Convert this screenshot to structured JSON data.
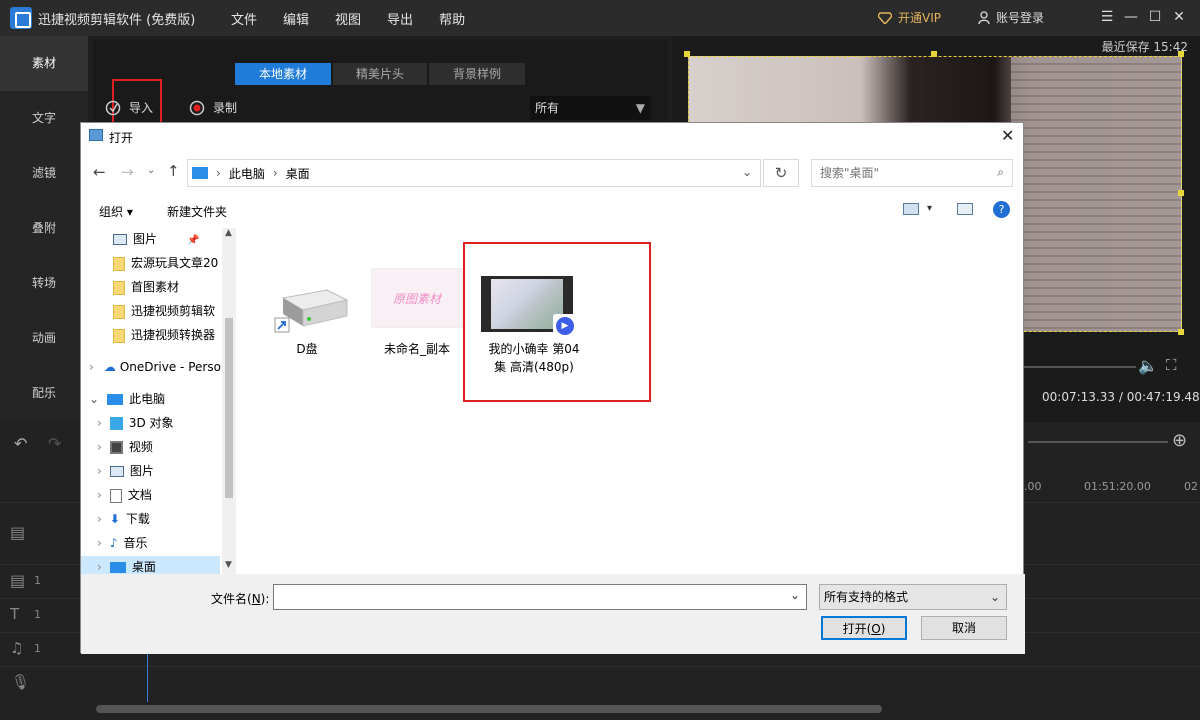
{
  "app": {
    "title": "迅捷视频剪辑软件 (免费版)",
    "menus": [
      "文件",
      "编辑",
      "视图",
      "导出",
      "帮助"
    ],
    "vip_label": "开通VIP",
    "account_label": "账号登录"
  },
  "leftnav": [
    "素材",
    "文字",
    "滤镜",
    "叠附",
    "转场",
    "动画",
    "配乐"
  ],
  "media": {
    "tabs": [
      "本地素材",
      "精美片头",
      "背景样例"
    ],
    "import_label": "导入",
    "record_label": "录制",
    "filter_value": "所有"
  },
  "preview": {
    "last_saved": "最近保存 15:42",
    "time_current": "00:07:13.33",
    "time_total": "00:47:19.48",
    "time_sep": "/"
  },
  "timeline": {
    "ruler_ticks": [
      ".00",
      "01:51:20.00",
      "02"
    ],
    "track_numbers": [
      "1",
      "1",
      "1"
    ]
  },
  "dialog": {
    "title": "打开",
    "breadcrumb": [
      "此电脑",
      "桌面"
    ],
    "search_placeholder": "搜索\"桌面\"",
    "organize_label": "组织",
    "new_folder_label": "新建文件夹",
    "tree": [
      "图片",
      "宏源玩具文章20",
      "首图素材",
      "迅捷视频剪辑软",
      "迅捷视频转换器",
      "OneDrive - Perso",
      "此电脑",
      "3D 对象",
      "视频",
      "图片",
      "文档",
      "下载",
      "音乐",
      "桌面"
    ],
    "files": [
      {
        "name": "D盘"
      },
      {
        "name": "未命名_副本",
        "thumb_text": "原图素材"
      },
      {
        "name_line1": "我的小确幸 第04",
        "name_line2": "集 高清(480p)"
      }
    ],
    "filename_label": "文件名(",
    "filename_key": "N",
    "filename_label_end": "):",
    "filename_value": "",
    "filetype_value": "所有支持的格式",
    "open_label": "打开(",
    "open_key": "O",
    "open_label_end": ")",
    "cancel_label": "取消"
  },
  "colors": {
    "accent": "#1f7cd9",
    "highlight_red": "#e02020",
    "vip": "#e2b45d"
  }
}
